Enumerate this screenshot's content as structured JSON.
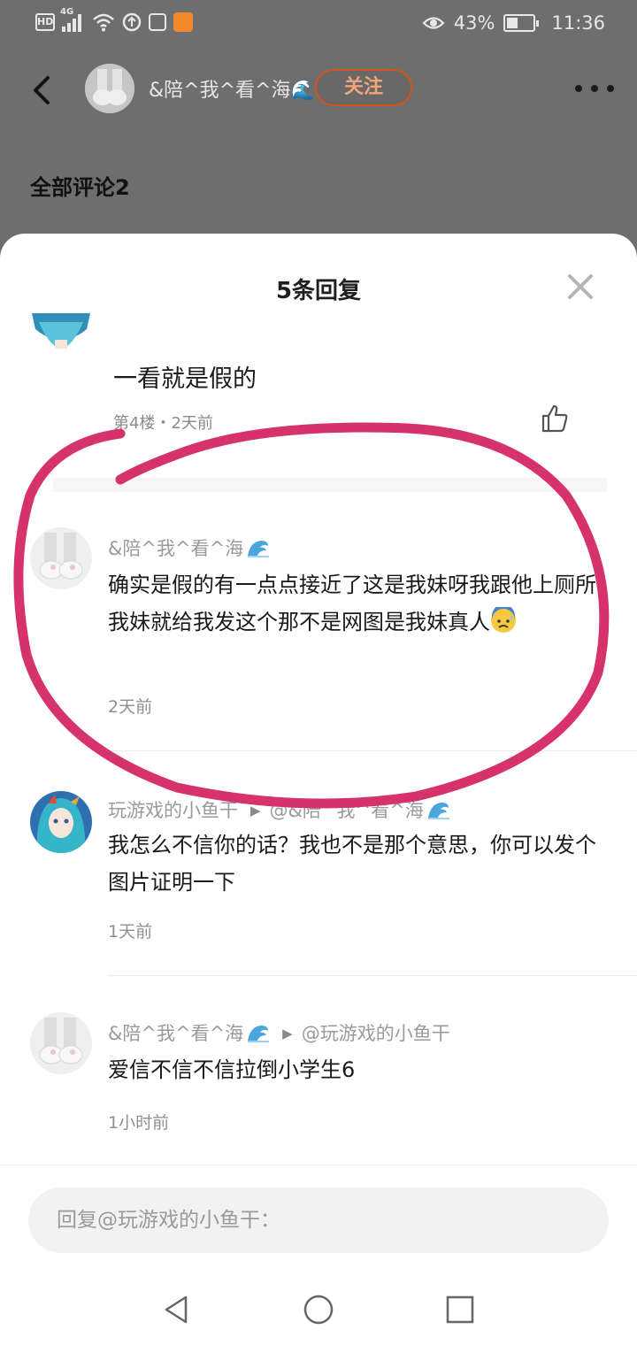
{
  "status_bar": {
    "network_label": "4G",
    "hd_label": "HD",
    "battery_percent": "43%",
    "battery_level": 0.43,
    "time": "11:36",
    "icons": [
      "hd-icon",
      "signal-icon",
      "wifi-icon",
      "data-saver-icon",
      "clipboard-icon",
      "app-notification-icon",
      "eye-icon",
      "battery-icon"
    ]
  },
  "header": {
    "username": "&陪^我^看^海🌊",
    "follow_label": "关注",
    "back_icon": "chevron-left-icon",
    "more_icon": "more-dots-icon"
  },
  "all_comments_label": "全部评论2",
  "sheet": {
    "title": "5条回复",
    "close_icon": "close-icon",
    "first_comment": {
      "text": "一看就是假的",
      "meta": "第4楼・2天前",
      "like_icon": "thumbs-up-icon"
    },
    "replies": [
      {
        "author": "&陪^我^看^海",
        "author_suffix_icon": "wave-emoji",
        "reply_to": "",
        "text": "确实是假的有一点点接近了这是我妹呀我跟他上厕所我妹就给我发这个那不是网图是我妹真人",
        "text_suffix_icon": "anxious-face-emoji",
        "time": "2天前"
      },
      {
        "author": "玩游戏的小鱼干",
        "reply_to": "@&陪^我^看^海",
        "reply_to_suffix_icon": "wave-emoji",
        "text": "我怎么不信你的话？我也不是那个意思，你可以发个图片证明一下",
        "time": "1天前"
      },
      {
        "author": "&陪^我^看^海",
        "author_suffix_icon": "wave-emoji",
        "reply_to": "@玩游戏的小鱼干",
        "text": "爱信不信不信拉倒小学生6",
        "time": "1小时前"
      }
    ]
  },
  "input": {
    "placeholder": "回复@玩游戏的小鱼干："
  },
  "nav": {
    "icons": [
      "nav-back-icon",
      "nav-home-icon",
      "nav-recents-icon"
    ]
  },
  "colors": {
    "accent": "#d4541a",
    "annotation": "#d6336c"
  }
}
